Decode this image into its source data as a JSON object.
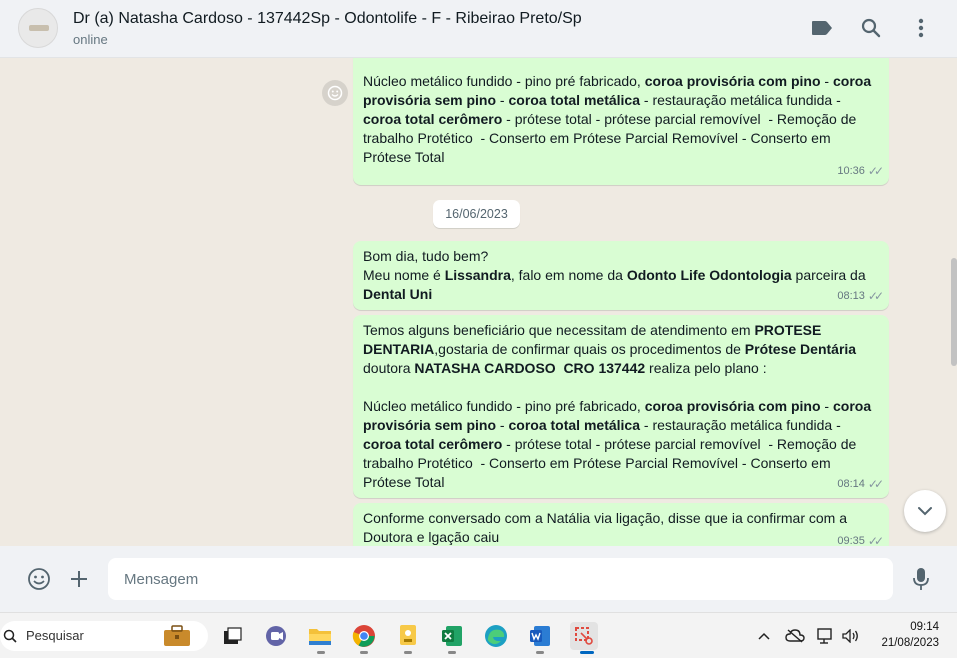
{
  "header": {
    "title": "Dr (a) Natasha Cardoso - 137442Sp - Odontolife - F - Ribeirao Preto/Sp",
    "status": "online"
  },
  "chat": {
    "date_divider": "16/06/2023",
    "messages": [
      {
        "segments": [
          {
            "t": "Núcleo metálico fundido - pino pré fabricado, "
          },
          {
            "t": "coroa provisória com pino",
            "b": true
          },
          {
            "t": " - "
          },
          {
            "t": "coroa provisória sem pino",
            "b": true
          },
          {
            "t": " - "
          },
          {
            "t": "coroa total metálica",
            "b": true
          },
          {
            "t": " - restauração metálica fundida - "
          },
          {
            "t": "coroa total cerômero",
            "b": true
          },
          {
            "t": " - prótese total - prótese parcial removível  - Remoção de trabalho Protético  - Conserto em Prótese Parcial Removível - Conserto em Prótese Total"
          }
        ],
        "time": "10:36"
      },
      {
        "segments": [
          {
            "t": "Bom dia, tudo bem?\nMeu nome é "
          },
          {
            "t": "Lissandra",
            "b": true
          },
          {
            "t": ", falo em nome da "
          },
          {
            "t": "Odonto Life Odontologia",
            "b": true
          },
          {
            "t": " parceira da "
          },
          {
            "t": "Dental Uni",
            "b": true
          }
        ],
        "time": "08:13"
      },
      {
        "segments": [
          {
            "t": "Temos alguns beneficiário que necessitam de atendimento em "
          },
          {
            "t": "PROTESE DENTARIA",
            "b": true
          },
          {
            "t": ",gostaria de confirmar quais os procedimentos de "
          },
          {
            "t": "Prótese Dentária",
            "b": true
          },
          {
            "t": " doutora "
          },
          {
            "t": "NATASHA CARDOSO  CRO 137442",
            "b": true
          },
          {
            "t": " realiza pelo plano :\n\nNúcleo metálico fundido - pino pré fabricado, "
          },
          {
            "t": "coroa provisória com pino",
            "b": true
          },
          {
            "t": " - "
          },
          {
            "t": "coroa provisória sem pino",
            "b": true
          },
          {
            "t": " - "
          },
          {
            "t": "coroa total metálica",
            "b": true
          },
          {
            "t": " - restauração metálica fundida - "
          },
          {
            "t": "coroa total cerômero",
            "b": true
          },
          {
            "t": " - prótese total - prótese parcial removível  - Remoção de trabalho Protético  - Conserto em Prótese Parcial Removível - Conserto em Prótese Total"
          }
        ],
        "time": "08:14"
      },
      {
        "segments": [
          {
            "t": "Conforme conversado com a Natália via ligação, disse que ia confirmar com a Doutora e lgação caiu"
          }
        ],
        "time": "09:35"
      }
    ]
  },
  "composer": {
    "placeholder": "Mensagem"
  },
  "taskbar": {
    "search_label": "Pesquisar",
    "time": "09:14",
    "date": "21/08/2023",
    "apps": [
      "briefcase-icon",
      "task-view-icon",
      "teams-icon",
      "file-explorer-icon",
      "chrome-icon",
      "sticky-notes-icon",
      "excel-icon",
      "edge-icon",
      "word-icon",
      "snipping-tool-icon"
    ]
  },
  "colors": {
    "outgoing_bubble": "#d9fdd3",
    "chat_background": "#efeae2",
    "header_background": "#f0f2f5"
  }
}
